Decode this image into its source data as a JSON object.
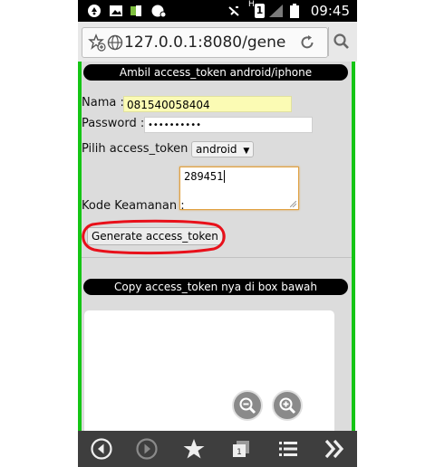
{
  "status_bar": {
    "time": "09:45",
    "signal_letter": "H",
    "sim_number": "1"
  },
  "browser": {
    "url": "127.0.0.1:8080/gene"
  },
  "form": {
    "header": "Ambil access_token android/iphone",
    "nama_label": "Nama :",
    "nama_value": "081540058404",
    "password_label": "Password :",
    "password_value": "••••••••••",
    "pilih_label": "Pilih access_token :",
    "select_value": "android",
    "kode_label": "Kode Keamanan :",
    "kode_value": "289451",
    "generate_label": "Generate access_token",
    "copy_header": "Copy access_token nya di box bawah"
  },
  "colors": {
    "border_green": "#15c515",
    "highlight_red": "#e8101a"
  },
  "icons": [
    "notification-icon",
    "image-icon",
    "app-icon",
    "chat-icon",
    "mute-icon",
    "sim-icon",
    "signal-icon",
    "battery-icon",
    "bookmark-add-icon",
    "globe-icon",
    "reload-icon",
    "search-icon",
    "zoom-out-icon",
    "zoom-in-icon",
    "back-icon",
    "forward-icon",
    "star-icon",
    "tabs-icon",
    "menu-icon",
    "more-icon"
  ]
}
